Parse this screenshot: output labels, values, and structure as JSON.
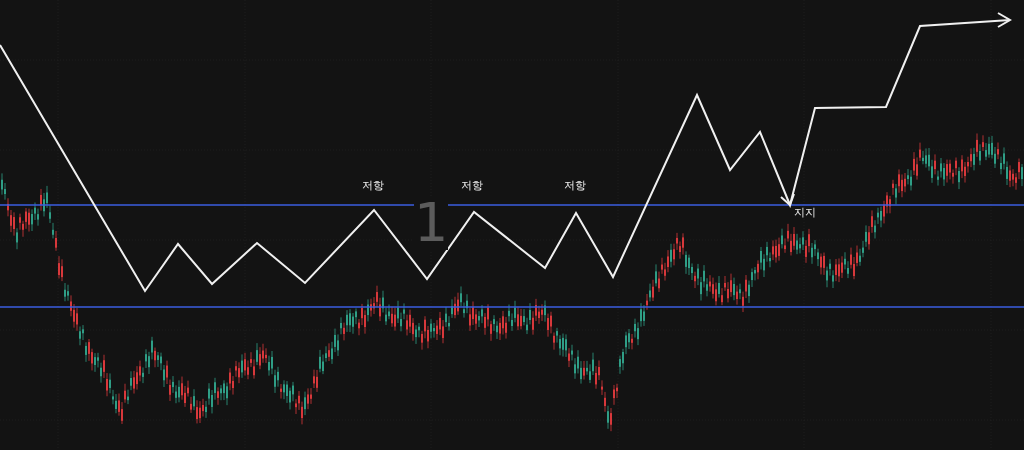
{
  "chart": {
    "symbol_number": "1",
    "annotations": [
      {
        "kind": "resistance",
        "text": "저항"
      },
      {
        "kind": "resistance",
        "text": "저항"
      },
      {
        "kind": "resistance",
        "text": "저항"
      },
      {
        "kind": "support",
        "text": "지지"
      }
    ]
  }
}
